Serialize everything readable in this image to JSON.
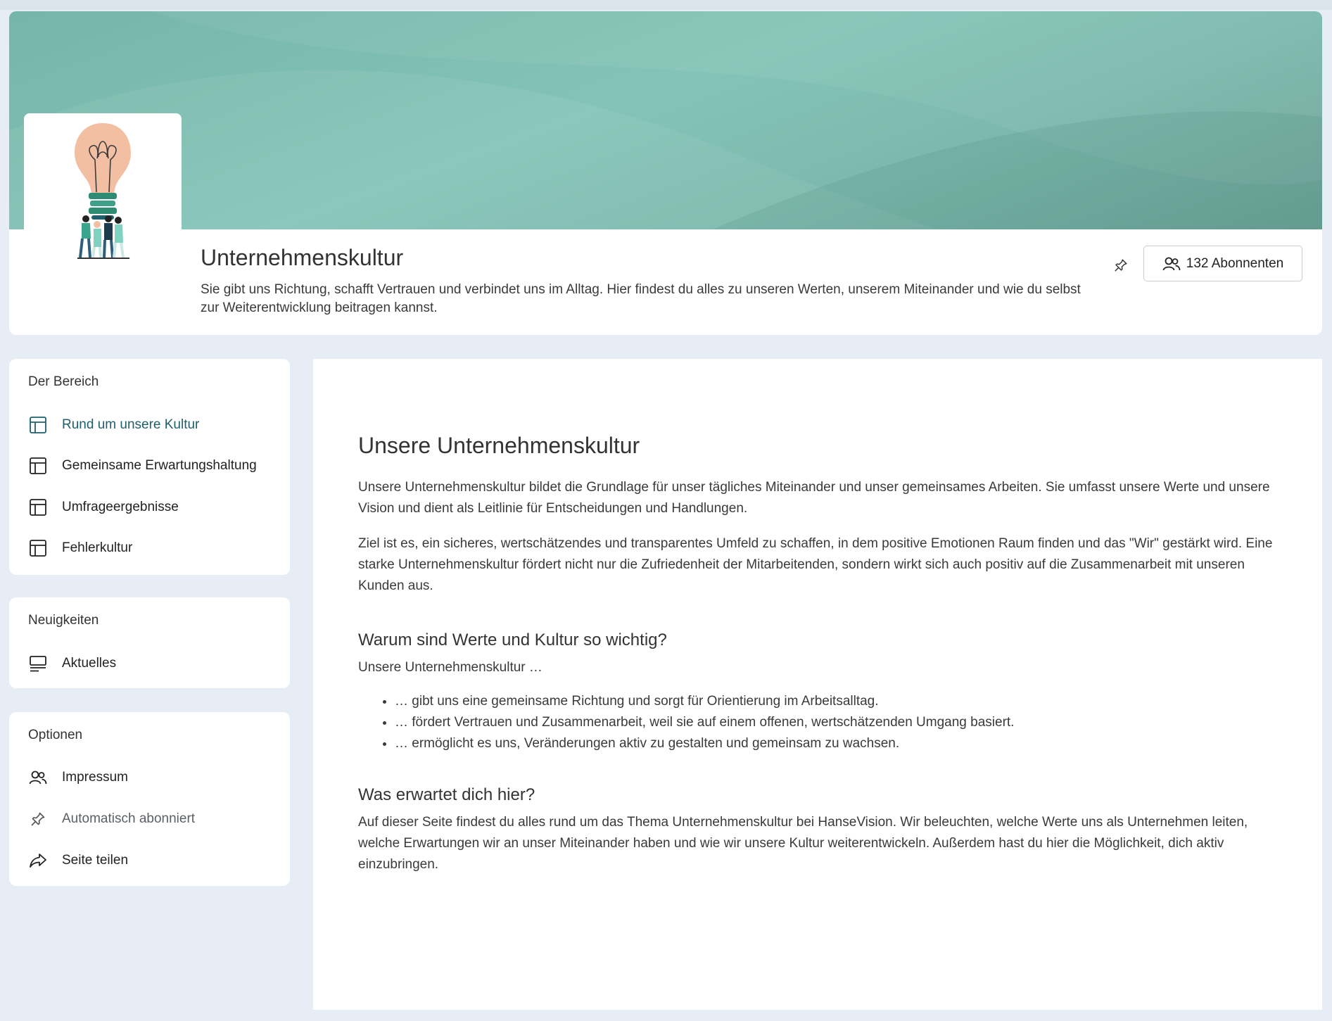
{
  "space": {
    "title": "Unternehmenskultur",
    "description": "Sie gibt uns Richtung, schafft Vertrauen und verbindet uns im Alltag. Hier findest du alles zu unseren Werten, unserem Miteinander und wie du selbst zur Weiterentwicklung beitragen kannst.",
    "subscribers_label": "132 Abonnenten"
  },
  "sidebar": {
    "area": {
      "title": "Der Bereich",
      "items": [
        {
          "label": "Rund um unsere Kultur",
          "icon": "page-layout-icon",
          "active": true
        },
        {
          "label": "Gemeinsame Erwartungshaltung",
          "icon": "page-layout-icon"
        },
        {
          "label": "Umfrageergebnisse",
          "icon": "page-layout-icon"
        },
        {
          "label": "Fehlerkultur",
          "icon": "page-layout-icon"
        }
      ]
    },
    "news": {
      "title": "Neuigkeiten",
      "items": [
        {
          "label": "Aktuelles",
          "icon": "news-icon"
        }
      ]
    },
    "options": {
      "title": "Optionen",
      "items": [
        {
          "label": "Impressum",
          "icon": "users-icon"
        },
        {
          "label": "Automatisch abonniert",
          "icon": "pin-icon"
        },
        {
          "label": "Seite teilen",
          "icon": "share-icon"
        }
      ]
    }
  },
  "main": {
    "heading": "Unsere Unternehmenskultur",
    "paragraphs": [
      "Unsere Unternehmenskultur bildet die Grundlage für unser tägliches Miteinander und unser gemeinsames Arbeiten. Sie umfasst unsere Werte und unsere Vision und dient als Leitlinie für Entscheidungen und Handlungen.",
      "Ziel ist es, ein sicheres, wertschätzendes und transparentes Umfeld zu schaffen, in dem positive Emotionen Raum finden und das \"Wir\" gestärkt wird. Eine starke Unternehmenskultur fördert nicht nur die Zufriedenheit der Mitarbeitenden, sondern wirkt sich auch positiv auf die Zusammenarbeit mit unseren Kunden aus."
    ],
    "section_why": {
      "heading": "Warum sind Werte und Kultur so wichtig?",
      "intro": "Unsere Unternehmenskultur …",
      "bullets": [
        "… gibt uns eine gemeinsame Richtung und sorgt für Orientierung im Arbeitsalltag.",
        "… fördert Vertrauen und Zusammenarbeit, weil sie auf einem offenen, wertschätzenden Umgang basiert.",
        "… ermöglicht es uns, Veränderungen aktiv zu gestalten und gemeinsam zu wachsen."
      ]
    },
    "section_expect": {
      "heading": "Was erwartet dich hier?",
      "text": "Auf dieser Seite findest du alles rund um das Thema Unternehmenskultur bei HanseVision. Wir beleuchten, welche Werte uns als Unternehmen leiten, welche Erwartungen wir an unser Miteinander haben und wie wir unsere Kultur weiterentwickeln. Außerdem hast du hier die Möglichkeit, dich aktiv einzubringen."
    }
  },
  "colors": {
    "banner": "#7fbcb1",
    "active_nav": "#1f5e6b",
    "page_bg": "#e6edf4"
  }
}
